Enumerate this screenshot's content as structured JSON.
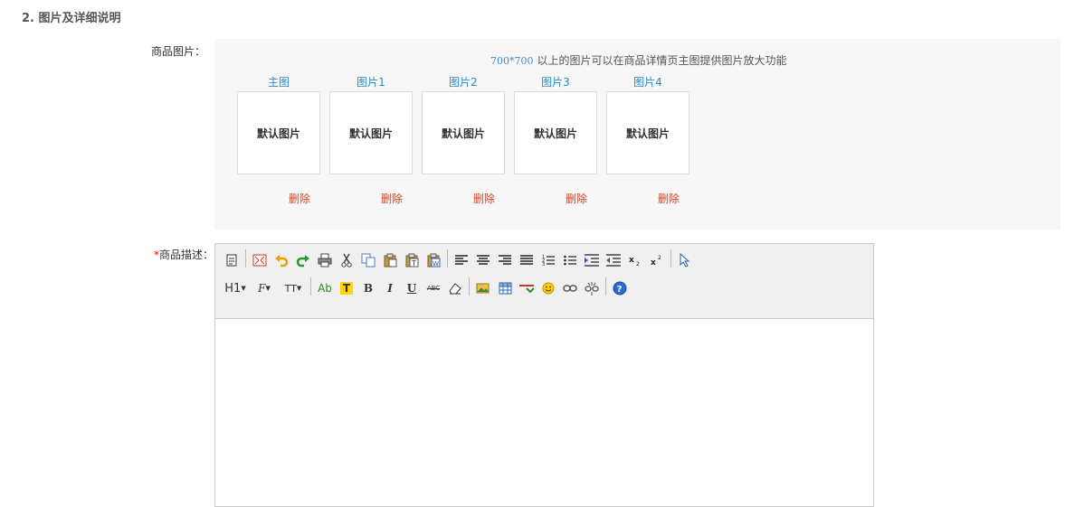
{
  "section": {
    "title": "2. 图片及详细说明"
  },
  "images": {
    "label": "商品图片：",
    "hint_dim": "700*700",
    "hint_text": "以上的图片可以在商品详情页主图提供图片放大功能",
    "slots": [
      {
        "title": "主图",
        "placeholder": "默认图片",
        "delete": "删除"
      },
      {
        "title": "图片1",
        "placeholder": "默认图片",
        "delete": "删除"
      },
      {
        "title": "图片2",
        "placeholder": "默认图片",
        "delete": "删除"
      },
      {
        "title": "图片3",
        "placeholder": "默认图片",
        "delete": "删除"
      },
      {
        "title": "图片4",
        "placeholder": "默认图片",
        "delete": "删除"
      }
    ]
  },
  "description": {
    "required_mark": "*",
    "label": "商品描述：",
    "toolbar": {
      "row1": [
        "source-icon",
        "fullscreen-icon",
        "undo-icon",
        "redo-icon",
        "print-icon",
        "cut-icon",
        "copy-icon",
        "paste-icon",
        "paste-text-icon",
        "paste-word-icon",
        "|",
        "align-left-icon",
        "align-center-icon",
        "align-right-icon",
        "justify-icon",
        "ordered-list-icon",
        "unordered-list-icon",
        "indent-icon",
        "outdent-icon",
        "subscript-icon",
        "superscript-icon",
        "|",
        "select-all-icon"
      ],
      "row2_text": {
        "heading": "H1",
        "font": "F",
        "size": "TT",
        "forecolor": "Ab",
        "hilite": "T",
        "bold": "B",
        "italic": "I",
        "underline": "U",
        "strike": "ABC"
      }
    }
  },
  "colors": {
    "link": "#2a8ac6",
    "delete": "#c8492d",
    "required": "#e00000",
    "panel": "#f7f7f7"
  }
}
